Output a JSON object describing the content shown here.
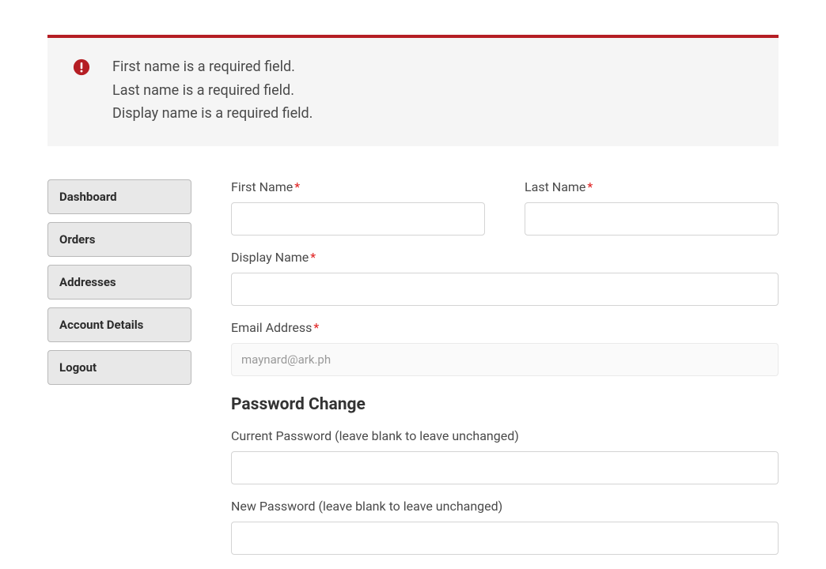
{
  "alert": {
    "messages": [
      "First name is a required field.",
      "Last name is a required field.",
      "Display name is a required field."
    ]
  },
  "sidebar": {
    "items": [
      {
        "label": "Dashboard"
      },
      {
        "label": "Orders"
      },
      {
        "label": "Addresses"
      },
      {
        "label": "Account Details"
      },
      {
        "label": "Logout"
      }
    ]
  },
  "form": {
    "first_name": {
      "label": "First Name",
      "value": ""
    },
    "last_name": {
      "label": "Last Name",
      "value": ""
    },
    "display_name": {
      "label": "Display Name",
      "value": ""
    },
    "email": {
      "label": "Email Address",
      "value": "maynard@ark.ph"
    }
  },
  "password_section": {
    "heading": "Password Change",
    "current": {
      "label": "Current Password (leave blank to leave unchanged)",
      "value": ""
    },
    "new": {
      "label": "New Password (leave blank to leave unchanged)",
      "value": ""
    }
  },
  "colors": {
    "brand": "#b51e24",
    "required": "#e02020"
  }
}
